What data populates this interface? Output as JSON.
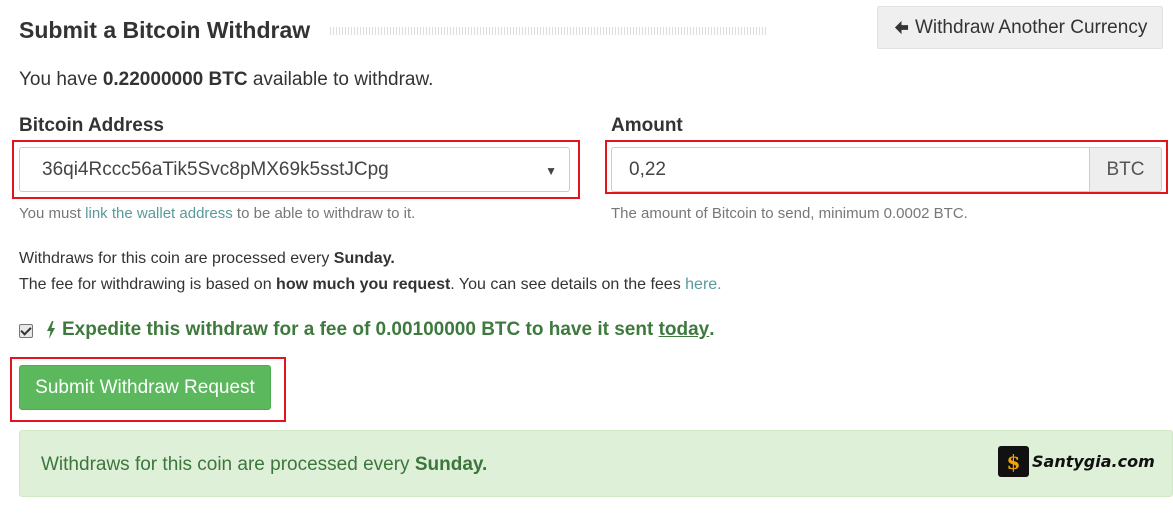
{
  "header": {
    "title": "Submit a Bitcoin Withdraw",
    "back_button_label": "Withdraw Another Currency",
    "back_button_icon": "arrow-left-icon"
  },
  "balance": {
    "prefix": "You have",
    "amount": "0.22000000 BTC",
    "suffix": "available to withdraw."
  },
  "address_field": {
    "label": "Bitcoin Address",
    "selected_value": "36qi4Rccc56aTik5Svc8pMX69k5sstJCpg",
    "caret": "▼",
    "help_prefix": "You must",
    "help_link": "link the wallet address",
    "help_suffix": "to be able to withdraw to it."
  },
  "amount_field": {
    "label": "Amount",
    "value": "0,22",
    "unit": "BTC",
    "help": "The amount of Bitcoin to send, minimum 0.0002 BTC."
  },
  "info": {
    "line1_prefix": "Withdraws for this coin are processed every",
    "line1_day": "Sunday.",
    "line2_prefix": "The fee for withdrawing is based on",
    "line2_bold": "how much you request",
    "line2_middle": ". You can see details on the fees",
    "line2_link": "here."
  },
  "expedite": {
    "checked": true,
    "icon": "bolt-icon",
    "text_prefix": "Expedite this withdraw for a fee of 0.00100000 BTC to have it sent",
    "text_link": "today",
    "text_suffix": "."
  },
  "submit": {
    "label": "Submit Withdraw Request"
  },
  "alert": {
    "prefix": "Withdraws for this coin are processed every",
    "day": "Sunday."
  },
  "watermark": {
    "glyph": "$",
    "text": "Santygia.com"
  },
  "colors": {
    "highlight": "#e2151e",
    "success": "#5cb85c",
    "alert_bg": "#dff0d8",
    "alert_text": "#3c763d",
    "link": "#5a9a9a"
  }
}
